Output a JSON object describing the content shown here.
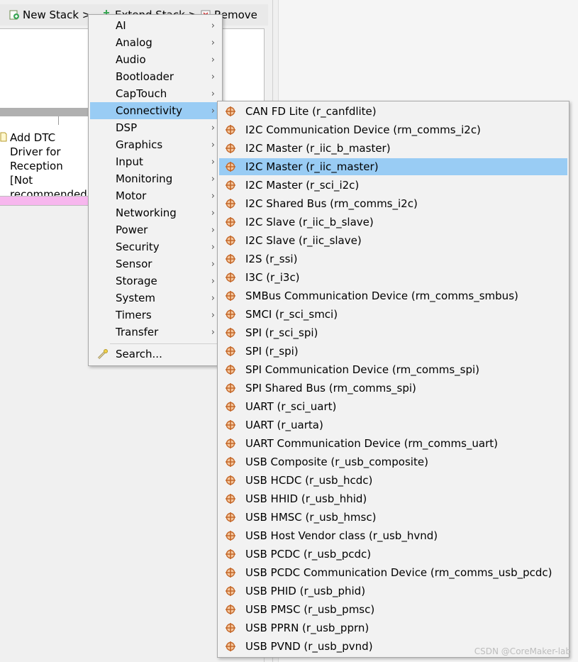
{
  "toolbar": {
    "new_stack": "New Stack >",
    "extend_stack": "Extend Stack >",
    "remove": "Remove"
  },
  "stack": {
    "text": "Add DTC Driver for Reception [Not recommended]"
  },
  "main_menu": {
    "items": [
      {
        "label": "AI"
      },
      {
        "label": "Analog"
      },
      {
        "label": "Audio"
      },
      {
        "label": "Bootloader"
      },
      {
        "label": "CapTouch"
      },
      {
        "label": "Connectivity"
      },
      {
        "label": "DSP"
      },
      {
        "label": "Graphics"
      },
      {
        "label": "Input"
      },
      {
        "label": "Monitoring"
      },
      {
        "label": "Motor"
      },
      {
        "label": "Networking"
      },
      {
        "label": "Power"
      },
      {
        "label": "Security"
      },
      {
        "label": "Sensor"
      },
      {
        "label": "Storage"
      },
      {
        "label": "System"
      },
      {
        "label": "Timers"
      },
      {
        "label": "Transfer"
      }
    ],
    "selected": "Connectivity",
    "search": "Search...",
    "arrow": "›"
  },
  "submenu": {
    "items": [
      {
        "label": "CAN FD Lite (r_canfdlite)"
      },
      {
        "label": "I2C Communication Device (rm_comms_i2c)"
      },
      {
        "label": "I2C Master (r_iic_b_master)"
      },
      {
        "label": "I2C Master (r_iic_master)"
      },
      {
        "label": "I2C Master (r_sci_i2c)"
      },
      {
        "label": "I2C Shared Bus (rm_comms_i2c)"
      },
      {
        "label": "I2C Slave (r_iic_b_slave)"
      },
      {
        "label": "I2C Slave (r_iic_slave)"
      },
      {
        "label": "I2S (r_ssi)"
      },
      {
        "label": "I3C (r_i3c)"
      },
      {
        "label": "SMBus Communication Device (rm_comms_smbus)"
      },
      {
        "label": "SMCI (r_sci_smci)"
      },
      {
        "label": "SPI (r_sci_spi)"
      },
      {
        "label": "SPI (r_spi)"
      },
      {
        "label": "SPI Communication Device (rm_comms_spi)"
      },
      {
        "label": "SPI Shared Bus (rm_comms_spi)"
      },
      {
        "label": "UART (r_sci_uart)"
      },
      {
        "label": "UART (r_uarta)"
      },
      {
        "label": "UART Communication Device (rm_comms_uart)"
      },
      {
        "label": "USB Composite (r_usb_composite)"
      },
      {
        "label": "USB HCDC (r_usb_hcdc)"
      },
      {
        "label": "USB HHID (r_usb_hhid)"
      },
      {
        "label": "USB HMSC (r_usb_hmsc)"
      },
      {
        "label": "USB Host Vendor class (r_usb_hvnd)"
      },
      {
        "label": "USB PCDC (r_usb_pcdc)"
      },
      {
        "label": "USB PCDC Communication Device (rm_comms_usb_pcdc)"
      },
      {
        "label": "USB PHID (r_usb_phid)"
      },
      {
        "label": "USB PMSC (r_usb_pmsc)"
      },
      {
        "label": "USB PPRN (r_usb_pprn)"
      },
      {
        "label": "USB PVND (r_usb_pvnd)"
      }
    ],
    "selected": "I2C Master (r_iic_master)"
  },
  "watermark": "CSDN @CoreMaker-lab",
  "colors": {
    "selection": "#99ccf4",
    "menu_bg": "#f2f2f2",
    "pink_bar": "#f7b7ee",
    "component_icon": "#c4682a"
  }
}
